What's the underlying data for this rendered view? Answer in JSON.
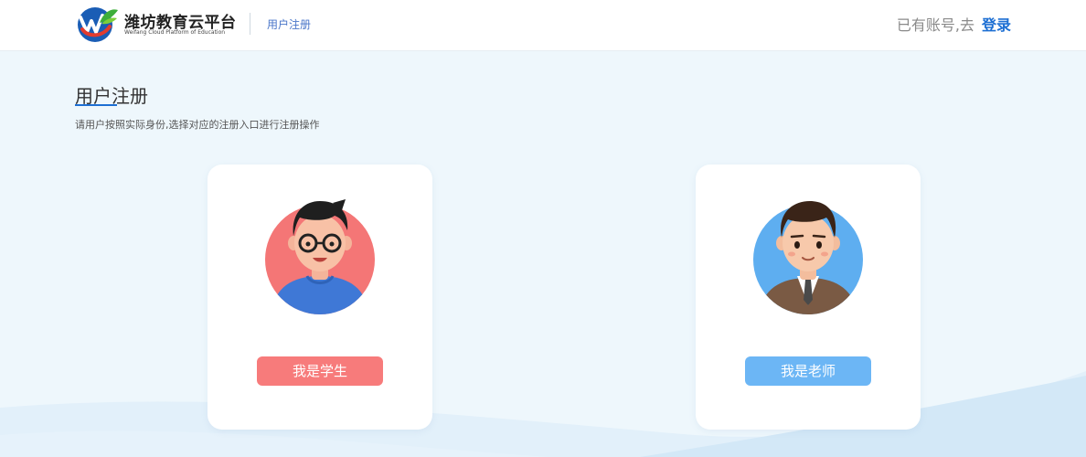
{
  "header": {
    "logo_icon": "weifang-cloud-logo",
    "logo_title": "潍坊教育云平台",
    "logo_subtitle": "Weifang Cloud Platform of Education",
    "page_link": "用户注册",
    "login_prompt": "已有账号,去",
    "login_link": "登录"
  },
  "main": {
    "title": "用户注册",
    "description": "请用户按照实际身份,选择对应的注册入口进行注册操作",
    "roles": [
      {
        "label": "我是学生",
        "avatar_icon": "student-avatar",
        "button_color": "#f77b7b",
        "avatar_bg_color": "#f47676"
      },
      {
        "label": "我是老师",
        "avatar_icon": "teacher-avatar",
        "button_color": "#6cb6f5",
        "avatar_bg_color": "#5eaef0"
      }
    ]
  },
  "colors": {
    "accent": "#1d6fd3",
    "background": "#eef7fc"
  }
}
